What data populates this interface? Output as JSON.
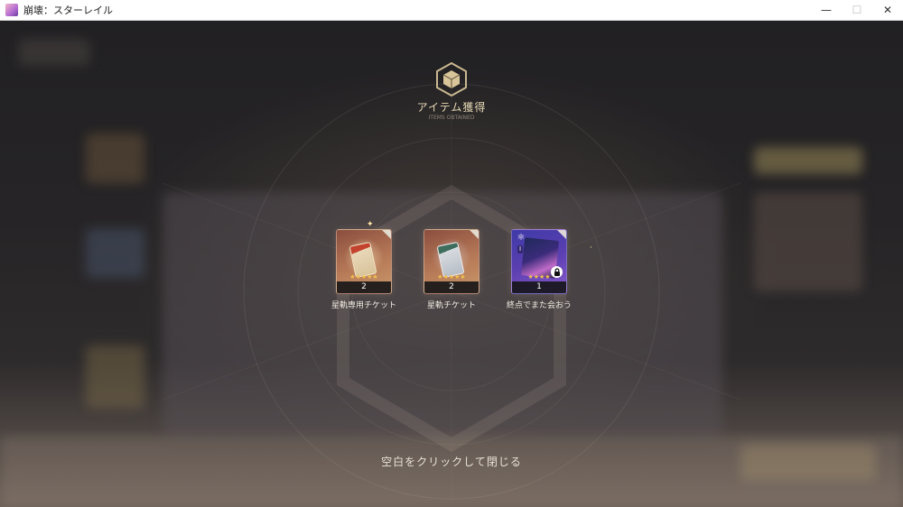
{
  "window": {
    "title": "崩壊：スターレイル",
    "controls": {
      "minimize": "—",
      "maximize": "☐",
      "close": "✕"
    }
  },
  "dialog": {
    "title": "アイテム獲得",
    "subtitle": "ITEMS OBTAINED",
    "close_hint": "空白をクリックして閉じる"
  },
  "items": [
    {
      "name": "星軌専用チケット",
      "count": "2",
      "stars": "★★★★★",
      "rarity": 5,
      "icon": "special-star-rail-pass-icon"
    },
    {
      "name": "星軌チケット",
      "count": "2",
      "stars": "★★★★★",
      "rarity": 5,
      "icon": "star-rail-pass-icon"
    },
    {
      "name": "終点でまた会おう",
      "count": "1",
      "stars": "★★★★",
      "rarity": 4,
      "icon": "light-cone-icon",
      "path_icon": "⚛",
      "rank_badge": "I",
      "locked": true
    }
  ],
  "colors": {
    "accent_gold": "#e7d9b5",
    "star_gold": "#f2c14e",
    "rarity5_card": "#b77a58",
    "rarity4_card": "#5b3fb0"
  }
}
